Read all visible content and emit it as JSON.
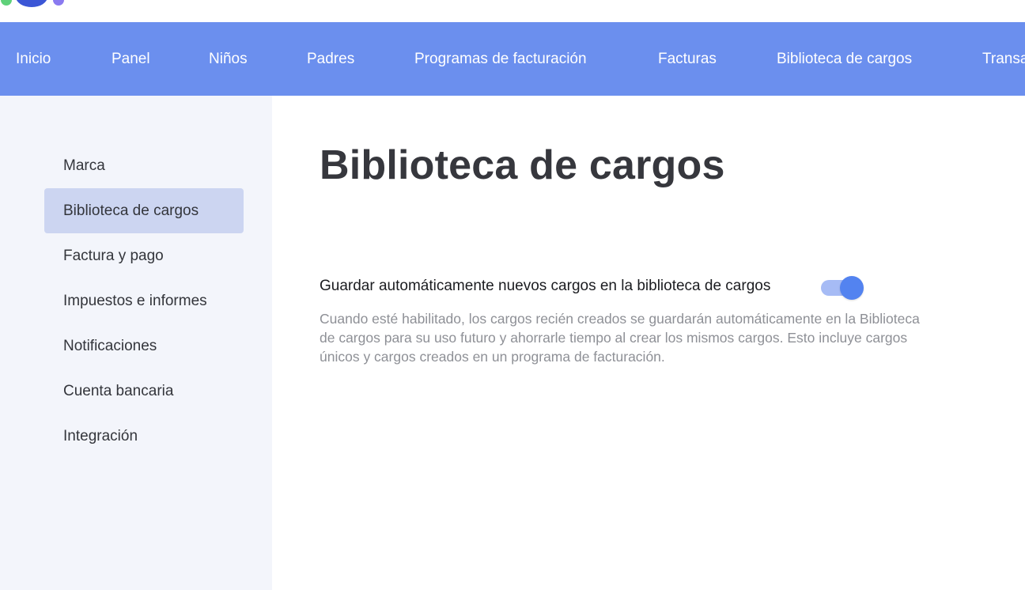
{
  "colors": {
    "nav_background": "#6b8fee",
    "sidebar_background": "#f3f5fb",
    "sidebar_active_background": "#ccd5f1",
    "toggle_on": "#5383f0",
    "toggle_track": "#a6bbf5"
  },
  "header": {
    "logo_icon": "brand-logo-icon"
  },
  "nav": {
    "items": [
      {
        "label": "Inicio"
      },
      {
        "label": "Panel"
      },
      {
        "label": "Niños"
      },
      {
        "label": "Padres"
      },
      {
        "label": "Programas de facturación"
      },
      {
        "label": "Facturas"
      },
      {
        "label": "Biblioteca de cargos"
      },
      {
        "label": "Transacciones"
      }
    ]
  },
  "sidebar": {
    "items": [
      {
        "label": "Marca",
        "active": false
      },
      {
        "label": "Biblioteca de cargos",
        "active": true
      },
      {
        "label": "Factura y pago",
        "active": false
      },
      {
        "label": "Impuestos e informes",
        "active": false
      },
      {
        "label": "Notificaciones",
        "active": false
      },
      {
        "label": "Cuenta bancaria",
        "active": false
      },
      {
        "label": "Integración",
        "active": false
      }
    ]
  },
  "main": {
    "title": "Biblioteca de cargos",
    "setting": {
      "label": "Guardar automáticamente nuevos cargos en la biblioteca de cargos",
      "enabled": true,
      "description": "Cuando esté habilitado, los cargos recién creados se guardarán automáticamente en la Biblioteca de cargos para su uso futuro y ahorrarle tiempo al crear los mismos cargos. Esto incluye cargos únicos y cargos creados en un programa de facturación."
    }
  }
}
